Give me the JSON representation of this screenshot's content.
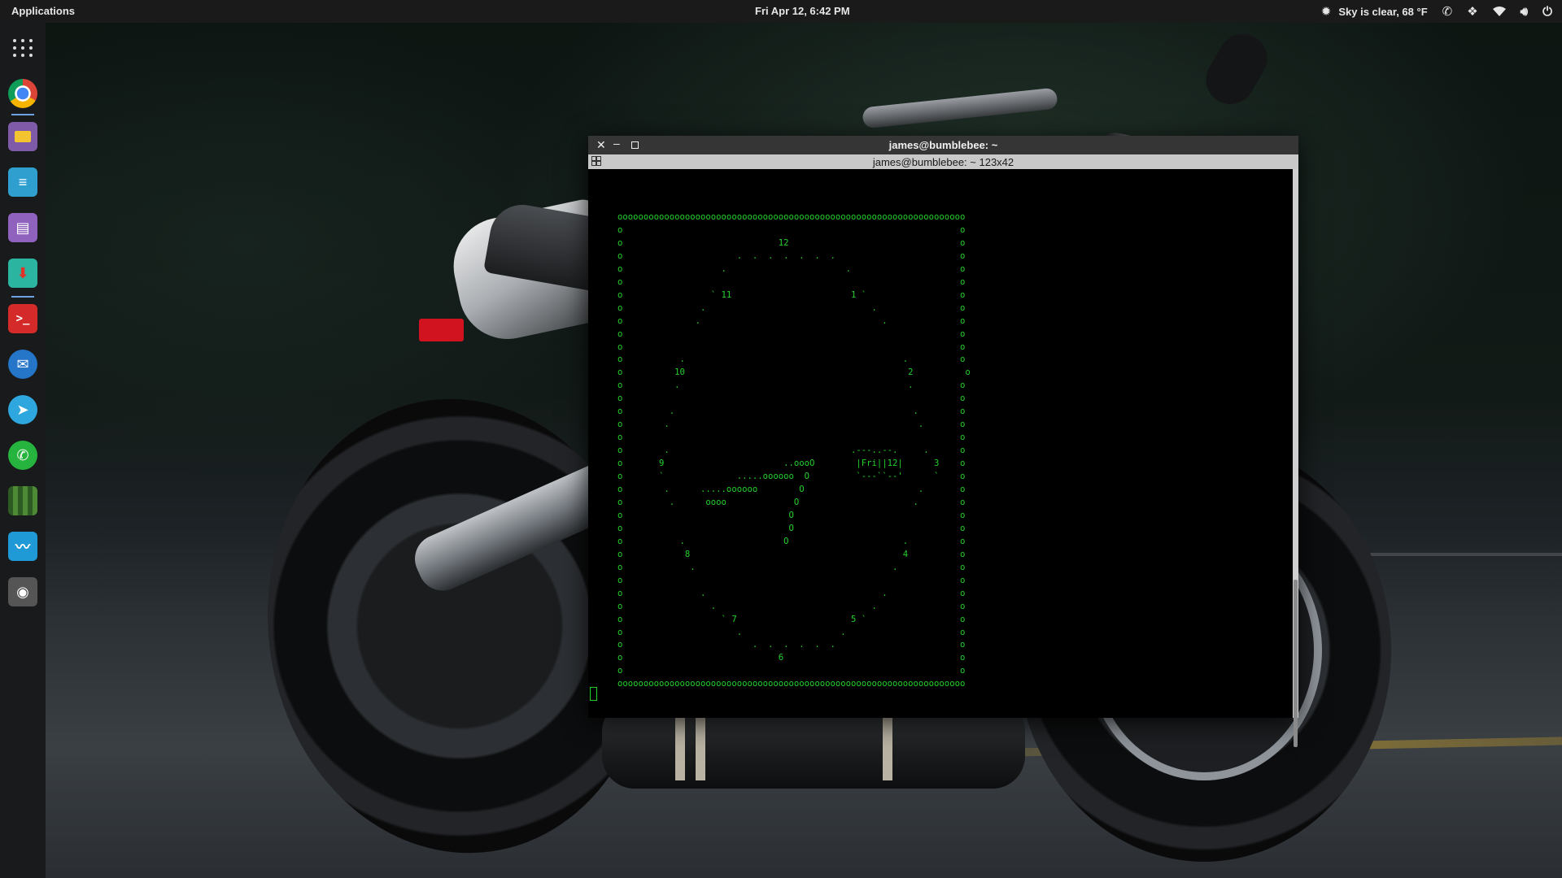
{
  "top_panel": {
    "applications_label": "Applications",
    "clock": "Fri Apr 12,  6:42 PM",
    "weather": "Sky is clear, 68 °F",
    "tray_icons": [
      "weather-clear-icon",
      "whatsapp-icon",
      "dropbox-icon",
      "wifi-icon",
      "volume-icon",
      "power-icon"
    ]
  },
  "dock": {
    "items": [
      {
        "name": "app-grid-icon",
        "color": "transparent"
      },
      {
        "name": "chrome-icon",
        "color": "#e8e8e8"
      },
      {
        "name": "files-icon",
        "color": "#8e5fb7"
      },
      {
        "name": "text-editor-icon",
        "color": "#35a8d8"
      },
      {
        "name": "document-viewer-icon",
        "color": "#9b6cc4"
      },
      {
        "name": "software-updater-icon",
        "color": "#2bb5a0"
      },
      {
        "name": "terminal-icon",
        "color": "#d92b2b"
      },
      {
        "name": "mail-client-icon",
        "color": "#2a7bd3"
      },
      {
        "name": "telegram-icon",
        "color": "#2ea6de"
      },
      {
        "name": "whatsapp-icon",
        "color": "#27b43e"
      },
      {
        "name": "minecraft-icon",
        "color": "#3b6d2b"
      },
      {
        "name": "system-monitor-icon",
        "color": "#1f9ad6"
      },
      {
        "name": "screenshot-icon",
        "color": "#5d5d5d"
      }
    ]
  },
  "terminal": {
    "window_title": "james@bumblebee: ~",
    "tab_title": "james@bumblebee: ~ 123x42",
    "clock_art": [
      "ooooooooooooooooooooooooooooooooooooooooooooooooooooooooooooooooooo",
      "o                                                                 o",
      "o                              12                                 o",
      "o                      .  .  .  .  .  .  .                        o",
      "o                   .                       .                     o",
      "o                                                                 o",
      "o                 ` 11                       1 `                  o",
      "o               .                                .                o",
      "o              .                                   .              o",
      "o                                                                 o",
      "o                                                                 o",
      "o           .                                          .          o",
      "o          10                                           2          o",
      "o          .                                            .         o",
      "o                                                                 o",
      "o         .                                              .        o",
      "o        .                                                .       o",
      "o                                                                 o",
      "o        .                                   .---..--.     .      o",
      "o       9                       ..oooO        |Fri||12|      3    o",
      "o       `              .....oooooo  O         `---``--'      `    o",
      "o        .      .....oooooo        O                      .       o",
      "o         .      oooo             O                      .        o",
      "o                                O                                o",
      "o                                O                                o",
      "o           .                   O                      .          o",
      "o            8                                         4          o",
      "o             .                                      .            o",
      "o                                                                 o",
      "o               .                                  .              o",
      "o                 .                              .                o",
      "o                   ` 7                      5 `                  o",
      "o                      .                   .                      o",
      "o                         .  .  .  .  .  .                        o",
      "o                              6                                  o",
      "o                                                                 o",
      "ooooooooooooooooooooooooooooooooooooooooooooooooooooooooooooooooooo"
    ],
    "text_color": "#22d12a"
  }
}
